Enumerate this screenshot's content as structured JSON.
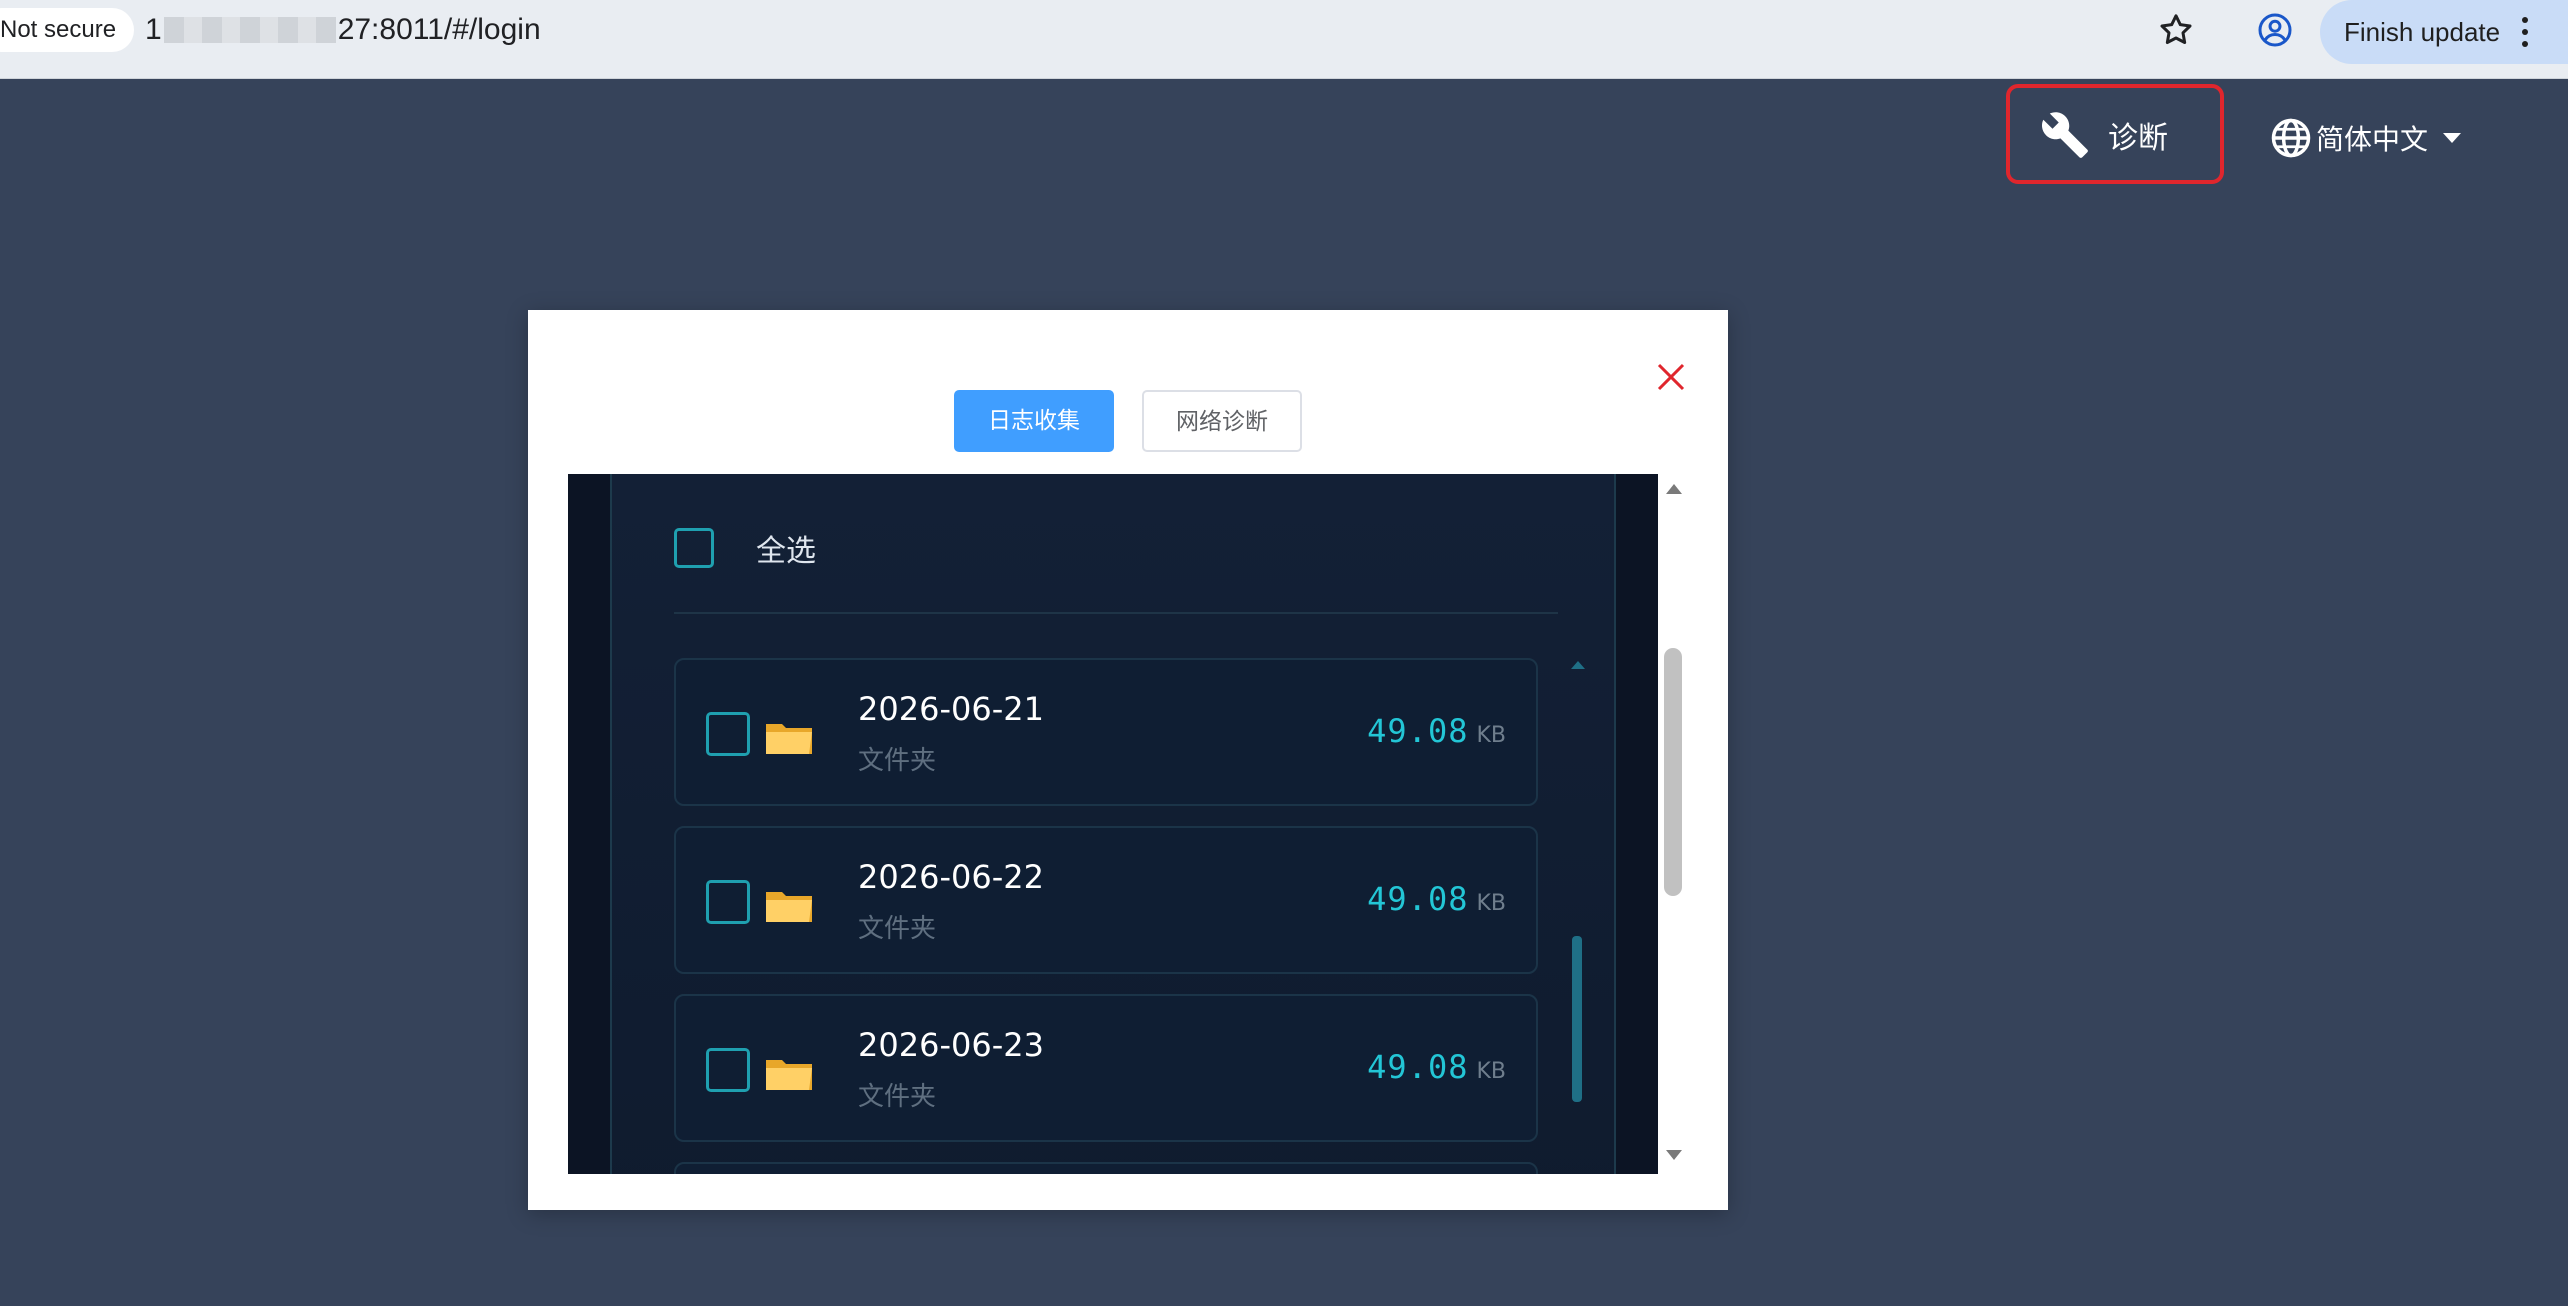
{
  "browser": {
    "security_label": "Not secure",
    "url_prefix": "1",
    "url_suffix": "27:8011/#/login",
    "finish_update_label": "Finish update"
  },
  "header": {
    "diagnose_label": "诊断",
    "language_label": "简体中文"
  },
  "modal": {
    "tabs": [
      {
        "label": "日志收集",
        "active": true
      },
      {
        "label": "网络诊断",
        "active": false
      }
    ],
    "select_all_label": "全选",
    "files": [
      {
        "name": "2026-06-21",
        "type": "文件夹",
        "size": "49.08",
        "unit": "KB"
      },
      {
        "name": "2026-06-22",
        "type": "文件夹",
        "size": "49.08",
        "unit": "KB"
      },
      {
        "name": "2026-06-23",
        "type": "文件夹",
        "size": "49.08",
        "unit": "KB"
      }
    ]
  },
  "colors": {
    "page_background": "#36435a",
    "primary_tab": "#409eff",
    "highlight_border": "#e0262d",
    "size_accent": "#23c6d6"
  }
}
